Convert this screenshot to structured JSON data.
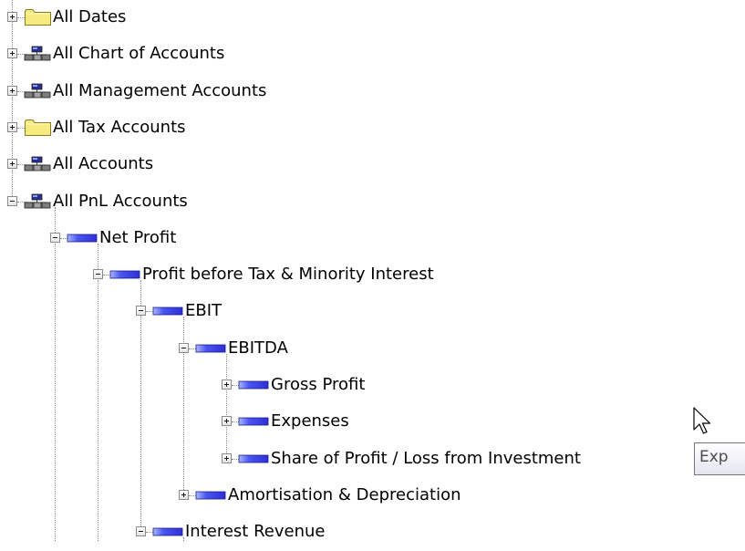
{
  "tree": {
    "nodes": [
      {
        "label": "All Dates",
        "icon": "folder-icon",
        "state": "collapsed"
      },
      {
        "label": "All Chart of Accounts",
        "icon": "hierarchy-icon",
        "state": "collapsed"
      },
      {
        "label": "All Management Accounts",
        "icon": "hierarchy-icon",
        "state": "collapsed"
      },
      {
        "label": "All Tax Accounts",
        "icon": "folder-icon",
        "state": "collapsed"
      },
      {
        "label": "All Accounts",
        "icon": "hierarchy-icon",
        "state": "collapsed"
      },
      {
        "label": "All PnL Accounts",
        "icon": "hierarchy-icon",
        "state": "expanded"
      },
      {
        "label": "Net Profit",
        "icon": "member-icon",
        "state": "expanded"
      },
      {
        "label": "Profit before Tax & Minority Interest",
        "icon": "member-icon",
        "state": "expanded"
      },
      {
        "label": "EBIT",
        "icon": "member-icon",
        "state": "expanded"
      },
      {
        "label": "EBITDA",
        "icon": "member-icon",
        "state": "expanded"
      },
      {
        "label": "Gross Profit",
        "icon": "member-icon",
        "state": "collapsed"
      },
      {
        "label": "Expenses",
        "icon": "member-icon",
        "state": "collapsed"
      },
      {
        "label": "Share of Profit / Loss from Investment",
        "icon": "member-icon",
        "state": "collapsed"
      },
      {
        "label": "Amortisation & Depreciation",
        "icon": "member-icon",
        "state": "collapsed"
      },
      {
        "label": "Interest Revenue",
        "icon": "member-icon",
        "state": "expanded"
      }
    ]
  },
  "tooltip": {
    "text": "Exp"
  },
  "colors": {
    "folder": "#f7ea7e",
    "member": "#2d2fd6",
    "tree_lines": "#8a8a8a",
    "tooltip_border": "#767676"
  }
}
